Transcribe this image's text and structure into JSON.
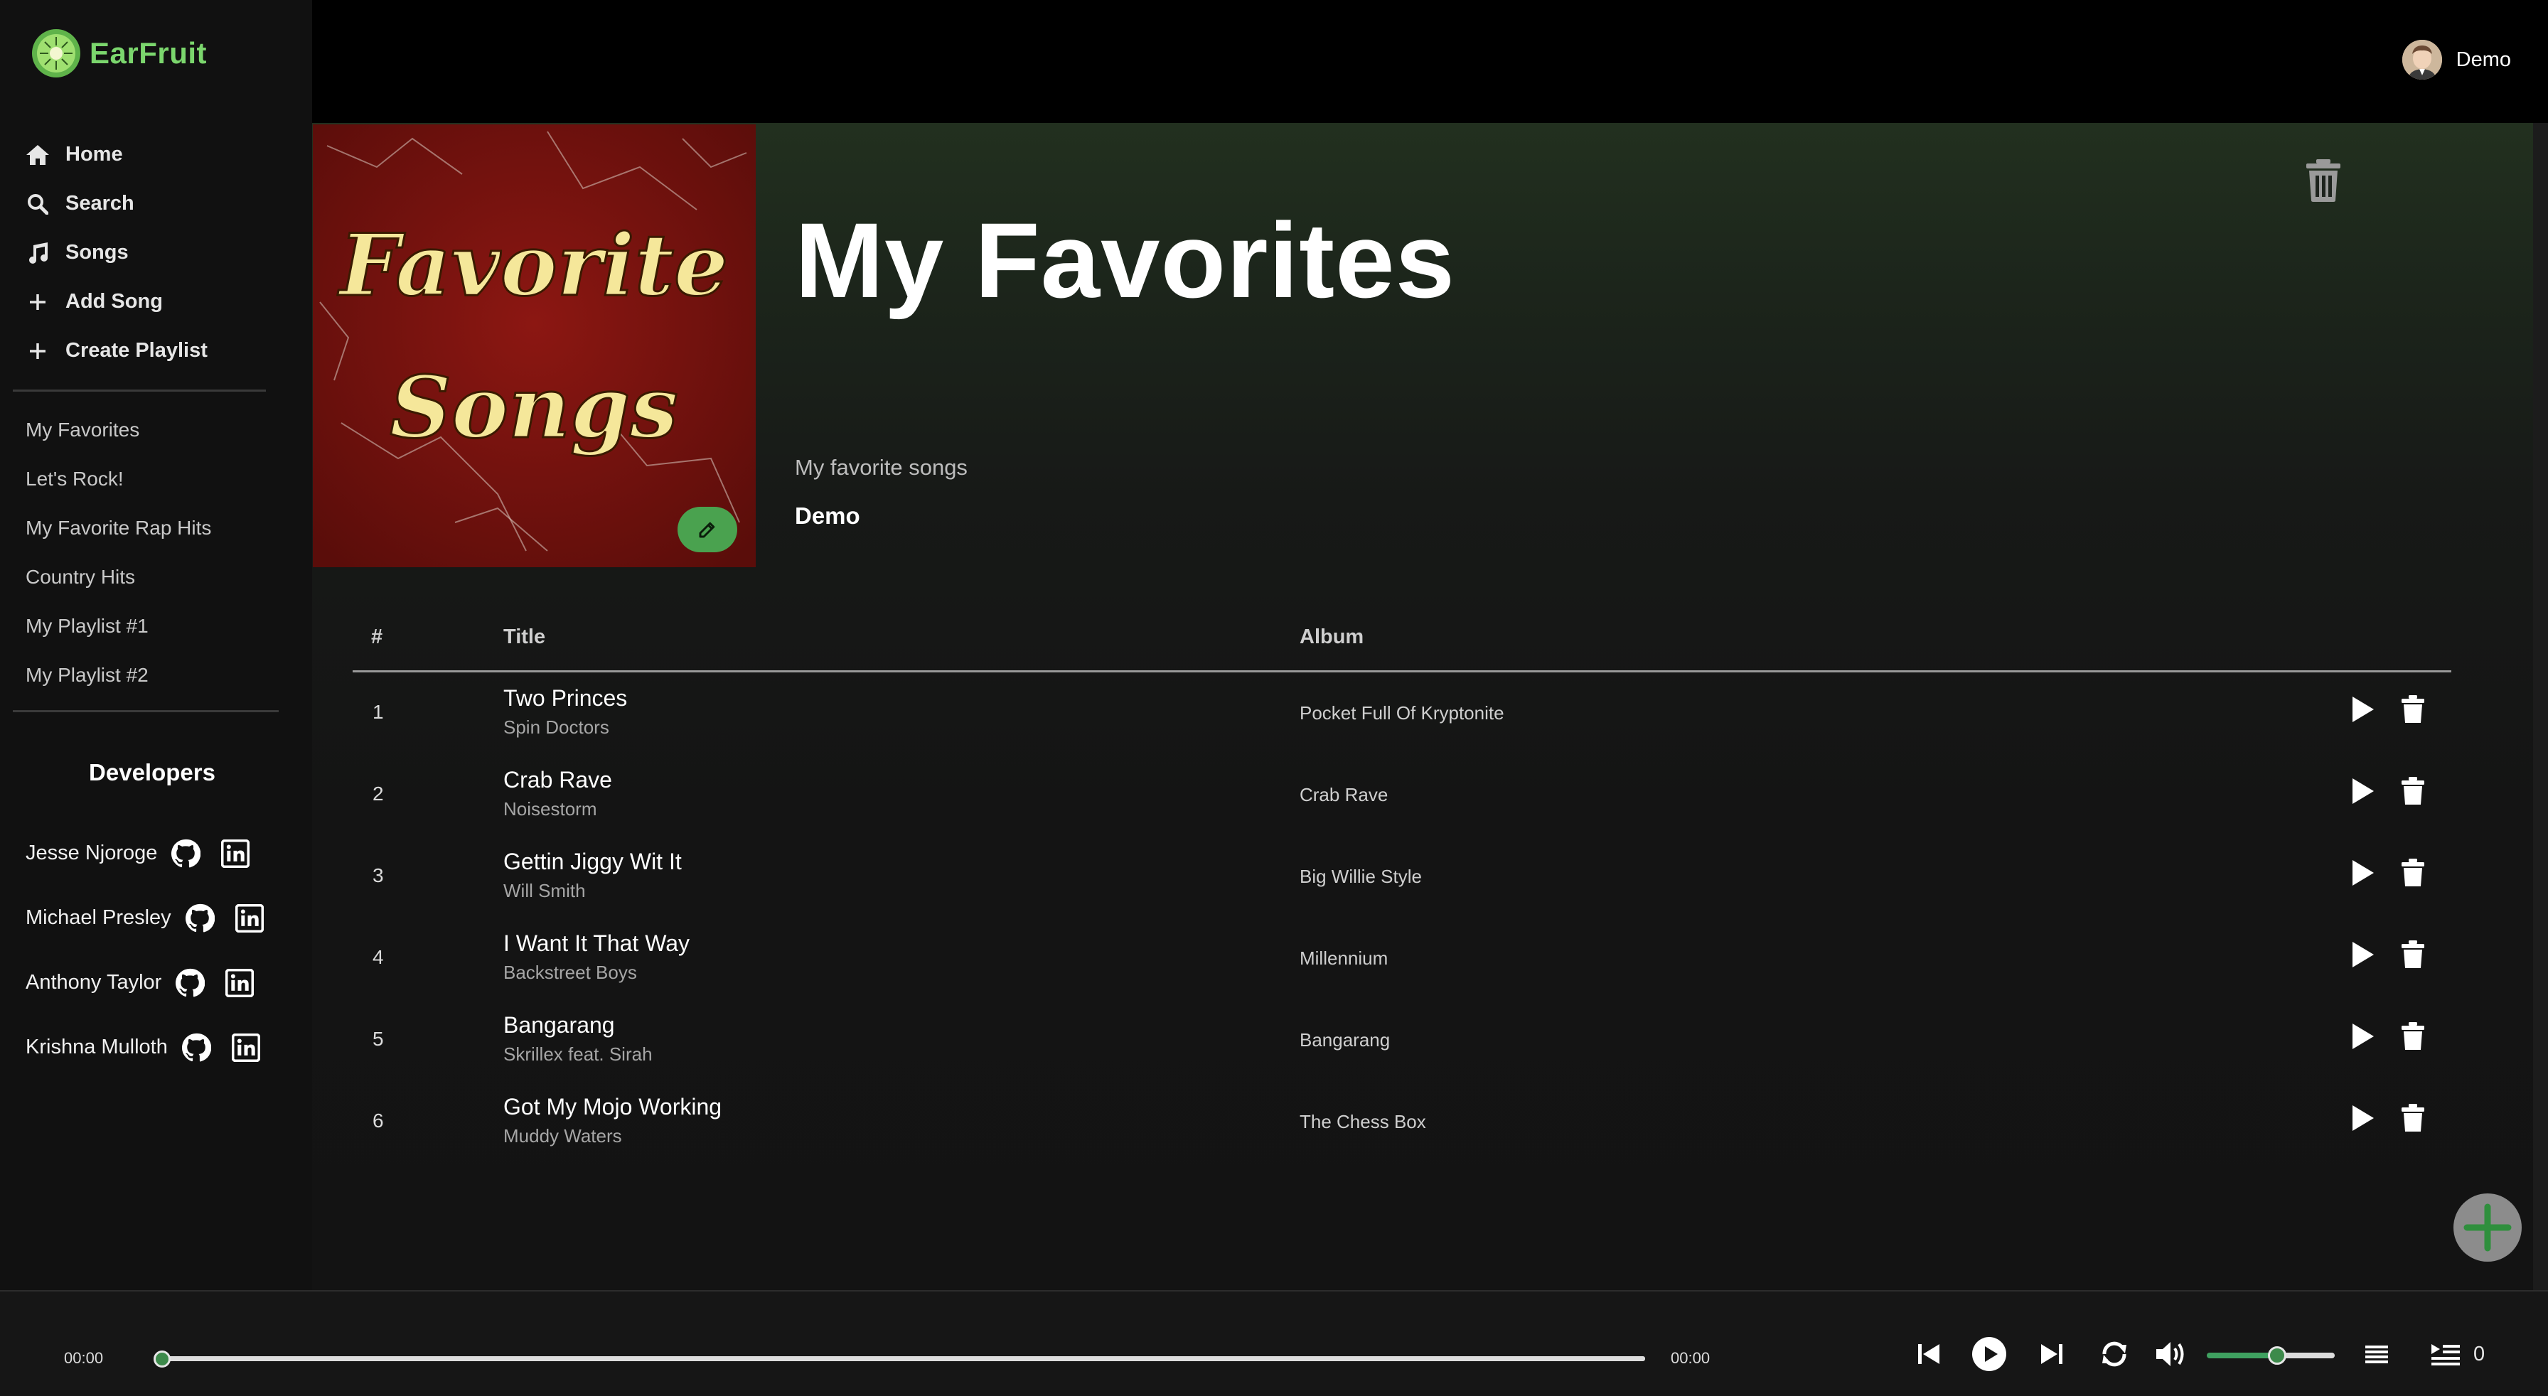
{
  "app": {
    "name": "EarFruit",
    "accent_color": "#7bd66d"
  },
  "nav": {
    "items": [
      {
        "label": "Home",
        "icon": "home-icon"
      },
      {
        "label": "Search",
        "icon": "search-icon"
      },
      {
        "label": "Songs",
        "icon": "music-note-icon"
      },
      {
        "label": "Add Song",
        "icon": "plus-icon"
      },
      {
        "label": "Create Playlist",
        "icon": "plus-icon"
      }
    ]
  },
  "playlists": [
    "My Favorites",
    "Let's Rock!",
    "My Favorite Rap Hits",
    "Country Hits",
    "My Playlist #1",
    "My Playlist #2"
  ],
  "developers": {
    "title": "Developers",
    "people": [
      {
        "name": "Jesse Njoroge"
      },
      {
        "name": "Michael Presley"
      },
      {
        "name": "Anthony Taylor"
      },
      {
        "name": "Krishna Mulloth"
      }
    ]
  },
  "user": {
    "name": "Demo"
  },
  "playlist": {
    "cover_text_line1": "Favorite",
    "cover_text_line2": "Songs",
    "title": "My Favorites",
    "description": "My favorite songs",
    "owner": "Demo"
  },
  "table": {
    "headers": {
      "number": "#",
      "title": "Title",
      "album": "Album"
    },
    "rows": [
      {
        "num": "1",
        "title": "Two Princes",
        "artist": "Spin Doctors",
        "album": "Pocket Full Of Kryptonite"
      },
      {
        "num": "2",
        "title": "Crab Rave",
        "artist": "Noisestorm",
        "album": "Crab Rave"
      },
      {
        "num": "3",
        "title": "Gettin Jiggy Wit It",
        "artist": "Will Smith",
        "album": "Big Willie Style"
      },
      {
        "num": "4",
        "title": "I Want It That Way",
        "artist": "Backstreet Boys",
        "album": "Millennium"
      },
      {
        "num": "5",
        "title": "Bangarang",
        "artist": "Skrillex feat. Sirah",
        "album": "Bangarang"
      },
      {
        "num": "6",
        "title": "Got My Mojo Working",
        "artist": "Muddy Waters",
        "album": "The Chess Box"
      }
    ]
  },
  "player": {
    "current_time": "00:00",
    "duration": "00:00",
    "progress_fraction": 0,
    "volume_fraction": 0.55,
    "queue_count": "0",
    "accent_color": "#3fa160"
  }
}
